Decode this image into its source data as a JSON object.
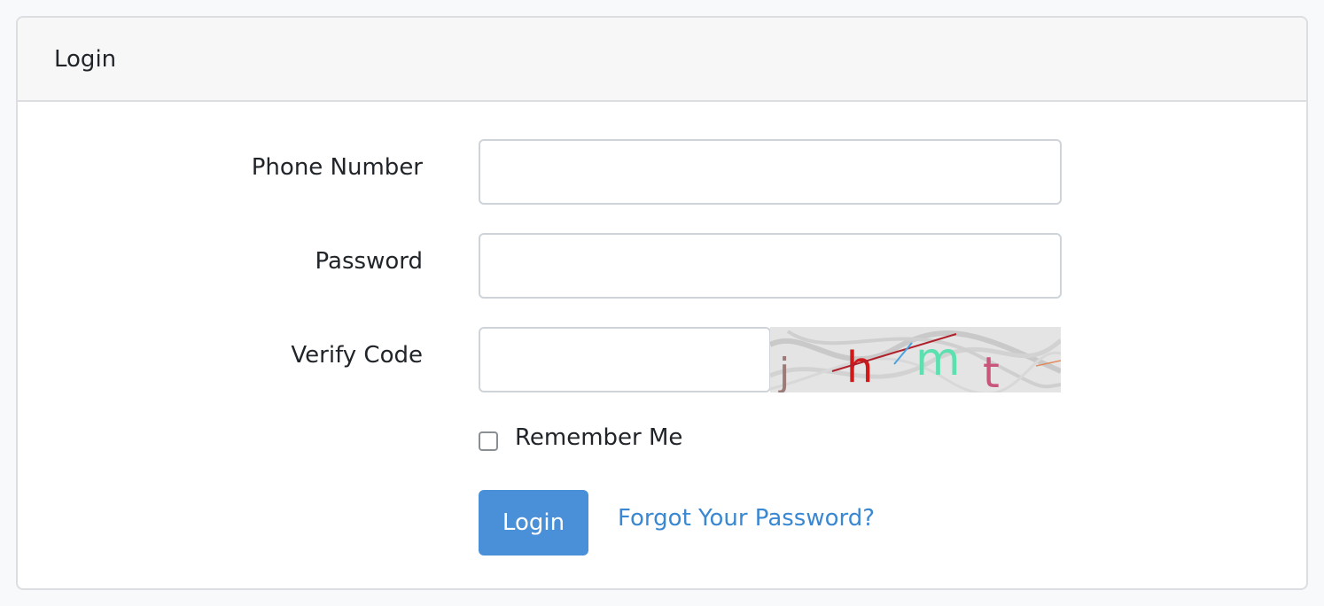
{
  "card": {
    "title": "Login"
  },
  "form": {
    "phone": {
      "label": "Phone Number",
      "value": "",
      "placeholder": ""
    },
    "password": {
      "label": "Password",
      "value": "",
      "placeholder": ""
    },
    "verify_code": {
      "label": "Verify Code",
      "value": "",
      "placeholder": ""
    },
    "captcha": {
      "chars": [
        "j",
        "h",
        "m",
        "t"
      ]
    },
    "remember": {
      "label": "Remember Me",
      "checked": false
    },
    "submit_label": "Login",
    "forgot_link": "Forgot Your Password?"
  },
  "colors": {
    "primary": "#4a90d9",
    "link": "#3a87d2",
    "header_bg": "#f7f7f7",
    "border": "#dcdee2"
  }
}
